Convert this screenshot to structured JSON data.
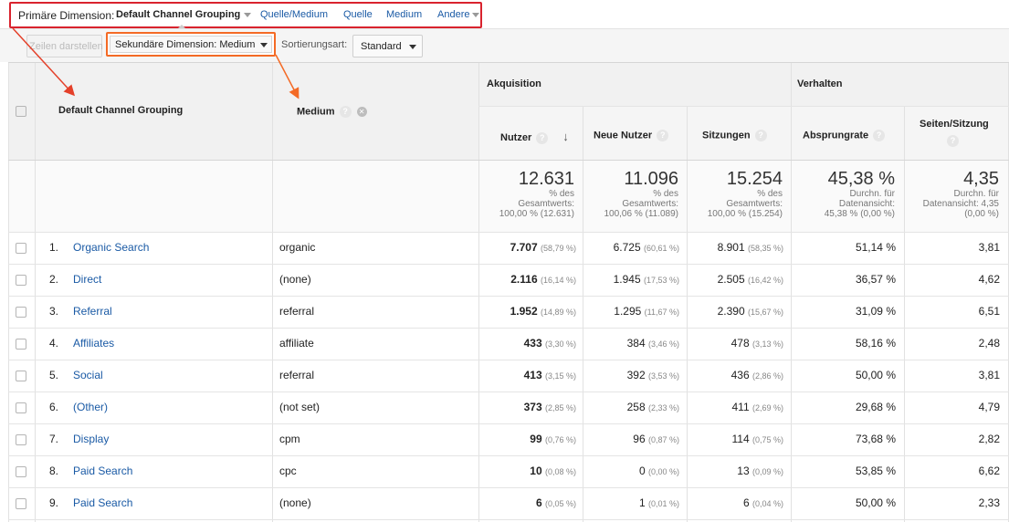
{
  "primary": {
    "label": "Primäre Dimension:",
    "active": "Default Channel Grouping",
    "links": [
      "Quelle/Medium",
      "Quelle",
      "Medium",
      "Andere"
    ]
  },
  "toolbar": {
    "rows_button": "Zeilen darstellen",
    "secondary_dimension": "Sekundäre Dimension: Medium",
    "sort_label": "Sortierungsart:",
    "sort_value": "Standard"
  },
  "headers": {
    "dim1": "Default Channel Grouping",
    "dim2": "Medium",
    "group_acq": "Akquisition",
    "group_beh": "Verhalten",
    "users": "Nutzer",
    "new_users": "Neue Nutzer",
    "sessions": "Sitzungen",
    "bounce": "Absprungrate",
    "pages": "Seiten/Sitzung"
  },
  "totals": {
    "users": {
      "big": "12.631",
      "l1": "% des",
      "l2": "Gesamtwerts:",
      "l3": "100,00 % (12.631)"
    },
    "new_users": {
      "big": "11.096",
      "l1": "% des",
      "l2": "Gesamtwerts:",
      "l3": "100,06 % (11.089)"
    },
    "sessions": {
      "big": "15.254",
      "l1": "% des",
      "l2": "Gesamtwerts:",
      "l3": "100,00 % (15.254)"
    },
    "bounce": {
      "big": "45,38 %",
      "l1": "Durchn. für",
      "l2": "Datenansicht:",
      "l3": "45,38 % (0,00 %)"
    },
    "pages": {
      "big": "4,35",
      "l1": "Durchn. für",
      "l2": "Datenansicht: 4,35",
      "l3": "(0,00 %)"
    }
  },
  "rows": [
    {
      "idx": "1.",
      "channel": "Organic Search",
      "medium": "organic",
      "users": "7.707",
      "users_pct": "(58,79 %)",
      "new_users": "6.725",
      "new_users_pct": "(60,61 %)",
      "sessions": "8.901",
      "sessions_pct": "(58,35 %)",
      "bounce": "51,14 %",
      "pages": "3,81"
    },
    {
      "idx": "2.",
      "channel": "Direct",
      "medium": "(none)",
      "users": "2.116",
      "users_pct": "(16,14 %)",
      "new_users": "1.945",
      "new_users_pct": "(17,53 %)",
      "sessions": "2.505",
      "sessions_pct": "(16,42 %)",
      "bounce": "36,57 %",
      "pages": "4,62"
    },
    {
      "idx": "3.",
      "channel": "Referral",
      "medium": "referral",
      "users": "1.952",
      "users_pct": "(14,89 %)",
      "new_users": "1.295",
      "new_users_pct": "(11,67 %)",
      "sessions": "2.390",
      "sessions_pct": "(15,67 %)",
      "bounce": "31,09 %",
      "pages": "6,51"
    },
    {
      "idx": "4.",
      "channel": "Affiliates",
      "medium": "affiliate",
      "users": "433",
      "users_pct": "(3,30 %)",
      "new_users": "384",
      "new_users_pct": "(3,46 %)",
      "sessions": "478",
      "sessions_pct": "(3,13 %)",
      "bounce": "58,16 %",
      "pages": "2,48"
    },
    {
      "idx": "5.",
      "channel": "Social",
      "medium": "referral",
      "users": "413",
      "users_pct": "(3,15 %)",
      "new_users": "392",
      "new_users_pct": "(3,53 %)",
      "sessions": "436",
      "sessions_pct": "(2,86 %)",
      "bounce": "50,00 %",
      "pages": "3,81"
    },
    {
      "idx": "6.",
      "channel": "(Other)",
      "medium": "(not set)",
      "users": "373",
      "users_pct": "(2,85 %)",
      "new_users": "258",
      "new_users_pct": "(2,33 %)",
      "sessions": "411",
      "sessions_pct": "(2,69 %)",
      "bounce": "29,68 %",
      "pages": "4,79"
    },
    {
      "idx": "7.",
      "channel": "Display",
      "medium": "cpm",
      "users": "99",
      "users_pct": "(0,76 %)",
      "new_users": "96",
      "new_users_pct": "(0,87 %)",
      "sessions": "114",
      "sessions_pct": "(0,75 %)",
      "bounce": "73,68 %",
      "pages": "2,82"
    },
    {
      "idx": "8.",
      "channel": "Paid Search",
      "medium": "cpc",
      "users": "10",
      "users_pct": "(0,08 %)",
      "new_users": "0",
      "new_users_pct": "(0,00 %)",
      "sessions": "13",
      "sessions_pct": "(0,09 %)",
      "bounce": "53,85 %",
      "pages": "6,62"
    },
    {
      "idx": "9.",
      "channel": "Paid Search",
      "medium": "(none)",
      "users": "6",
      "users_pct": "(0,05 %)",
      "new_users": "1",
      "new_users_pct": "(0,01 %)",
      "sessions": "6",
      "sessions_pct": "(0,04 %)",
      "bounce": "50,00 %",
      "pages": "2,33"
    }
  ],
  "icons": {
    "help": "help-icon",
    "close": "close-icon",
    "sort": "sort-arrow-icon"
  },
  "colors": {
    "link": "#1a5aa5",
    "highlight_red": "#d9232e",
    "highlight_orange": "#f46a25"
  }
}
